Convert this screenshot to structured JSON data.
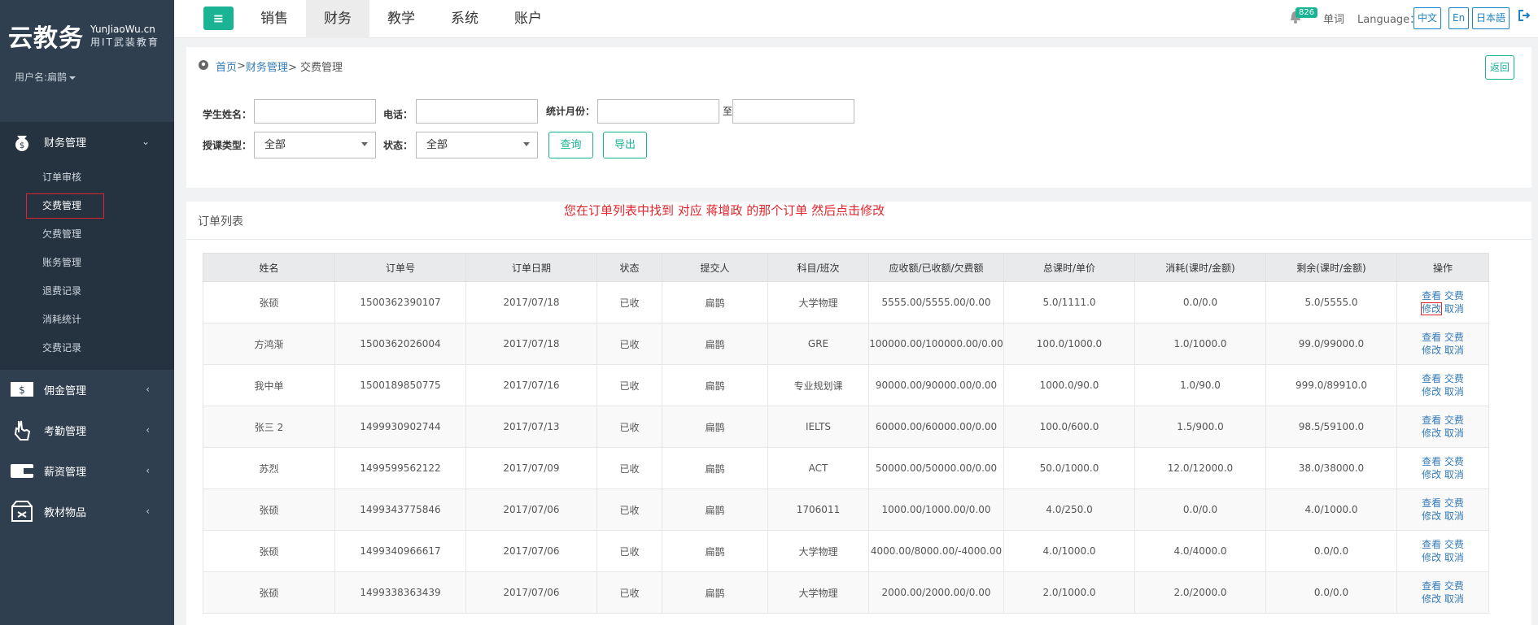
{
  "logo": {
    "main": "云教务",
    "en": "YunJiaoWu.cn",
    "cn": "用IT武装教育"
  },
  "user": {
    "label": "用户名:扁鹊"
  },
  "sidebar": {
    "sections": [
      {
        "label": "财务管理",
        "icon": "money-bag-icon",
        "arrow": "⌄"
      },
      {
        "label": "佣金管理",
        "icon": "dollar-bill-icon",
        "arrow": "‹"
      },
      {
        "label": "考勤管理",
        "icon": "hand-tap-icon",
        "arrow": "‹"
      },
      {
        "label": "薪资管理",
        "icon": "wallet-icon",
        "arrow": "‹"
      },
      {
        "label": "教材物品",
        "icon": "box-icon",
        "arrow": "‹"
      }
    ],
    "sub_items": [
      "订单审核",
      "交费管理",
      "欠费管理",
      "账务管理",
      "退费记录",
      "消耗统计",
      "交费记录"
    ]
  },
  "topnav": {
    "tabs": [
      "销售",
      "财务",
      "教学",
      "系统",
      "账户"
    ],
    "active_tab": "财务",
    "badge": "826",
    "words": "单词",
    "language_label": "Language：",
    "languages": [
      "中文",
      "En",
      "日本語"
    ]
  },
  "breadcrumb": {
    "home": "首页",
    "sep1": " >",
    "finance": "财务管理",
    "current": "> 交费管理",
    "back": "返回"
  },
  "filters": {
    "student_name_label": "学生姓名：",
    "phone_label": "电话：",
    "month_label": "统计月份：",
    "to_label": "至",
    "course_type_label": "授课类型：",
    "course_type_value": "全部",
    "status_label": "状态：",
    "status_value": "全部",
    "query": "查询",
    "export": "导出"
  },
  "list": {
    "title": "订单列表",
    "hint": "您在订单列表中找到 对应 蒋增政 的那个订单  然后点击修改",
    "headers": [
      "姓名",
      "订单号",
      "订单日期",
      "状态",
      "提交人",
      "科目/班次",
      "应收额/已收额/欠费额",
      "总课时/单价",
      "消耗(课时/金额)",
      "剩余(课时/金额)",
      "操作"
    ],
    "ops": {
      "view": "查看",
      "pay": "交费",
      "edit": "修改",
      "cancel": "取消"
    },
    "rows": [
      [
        "张硕",
        "1500362390107",
        "2017/07/18",
        "已收",
        "扁鹊",
        "大学物理",
        "5555.00/5555.00/0.00",
        "5.0/1111.0",
        "0.0/0.0",
        "5.0/5555.0"
      ],
      [
        "方鸿渐",
        "1500362026004",
        "2017/07/18",
        "已收",
        "扁鹊",
        "GRE",
        "100000.00/100000.00/0.00",
        "100.0/1000.0",
        "1.0/1000.0",
        "99.0/99000.0"
      ],
      [
        "我中单",
        "1500189850775",
        "2017/07/16",
        "已收",
        "扁鹊",
        "专业规划课",
        "90000.00/90000.00/0.00",
        "1000.0/90.0",
        "1.0/90.0",
        "999.0/89910.0"
      ],
      [
        "张三 2",
        "1499930902744",
        "2017/07/13",
        "已收",
        "扁鹊",
        "IELTS",
        "60000.00/60000.00/0.00",
        "100.0/600.0",
        "1.5/900.0",
        "98.5/59100.0"
      ],
      [
        "苏烈",
        "1499599562122",
        "2017/07/09",
        "已收",
        "扁鹊",
        "ACT",
        "50000.00/50000.00/0.00",
        "50.0/1000.0",
        "12.0/12000.0",
        "38.0/38000.0"
      ],
      [
        "张硕",
        "1499343775846",
        "2017/07/06",
        "已收",
        "扁鹊",
        "1706011",
        "1000.00/1000.00/0.00",
        "4.0/250.0",
        "0.0/0.0",
        "4.0/1000.0"
      ],
      [
        "张硕",
        "1499340966617",
        "2017/07/06",
        "已收",
        "扁鹊",
        "大学物理",
        "4000.00/8000.00/-4000.00",
        "4.0/1000.0",
        "4.0/4000.0",
        "0.0/0.0"
      ],
      [
        "张硕",
        "1499338363439",
        "2017/07/06",
        "已收",
        "扁鹊",
        "大学物理",
        "2000.00/2000.00/0.00",
        "2.0/1000.0",
        "2.0/2000.0",
        "0.0/0.0"
      ]
    ]
  }
}
